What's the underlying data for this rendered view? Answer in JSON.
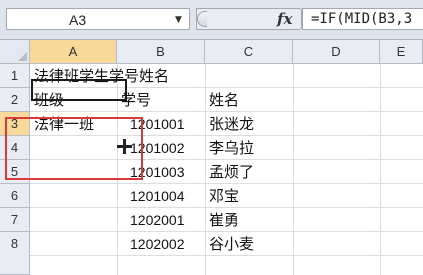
{
  "formula_bar": {
    "name_box": "A3",
    "fx_label": "fx",
    "formula": "=IF(MID(B3,3"
  },
  "columns": [
    "A",
    "B",
    "C",
    "D",
    "E"
  ],
  "rows": [
    "1",
    "2",
    "3",
    "4",
    "5",
    "6",
    "7",
    "8"
  ],
  "cells": {
    "A1": "法律班学生学号姓名",
    "A2": "班级",
    "B2": "学号",
    "C2": "姓名",
    "A3": "法律一班",
    "B3": "1201001",
    "C3": "张迷龙",
    "B4": "1201002",
    "C4": "李乌拉",
    "B5": "1201003",
    "C5": "孟烦了",
    "B6": "1201004",
    "C6": "邓宝",
    "B7": "1202001",
    "C7": "崔勇",
    "B8": "1202002",
    "C8": "谷小麦"
  },
  "selection": {
    "active_cell": "A3",
    "highlight_color": "#d83a3a"
  }
}
